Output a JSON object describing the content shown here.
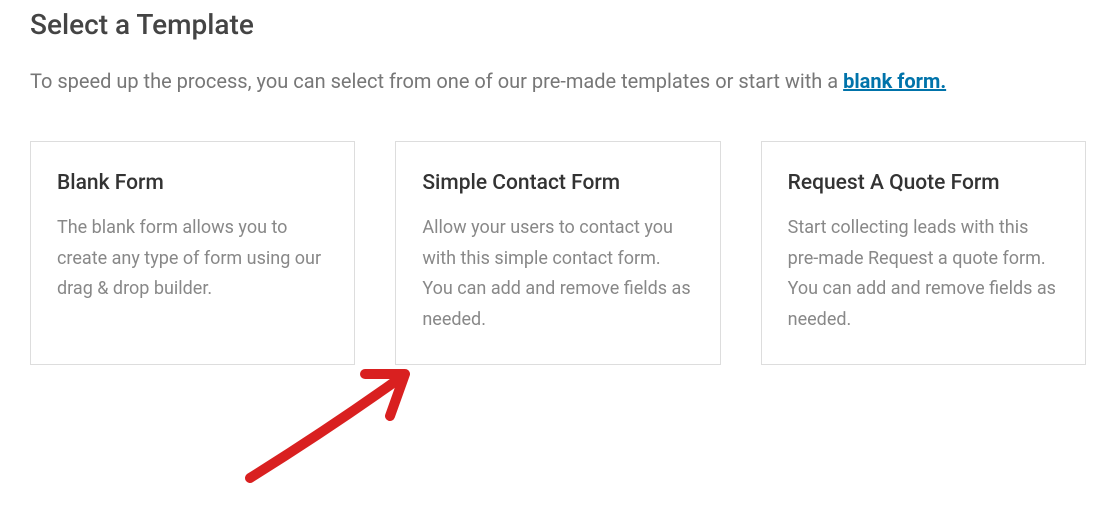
{
  "header": {
    "title": "Select a Template",
    "intro_prefix": "To speed up the process, you can select from one of our pre-made templates or start with a ",
    "intro_link": "blank form."
  },
  "cards": [
    {
      "title": "Blank Form",
      "desc": "The blank form allows you to create any type of form using our drag & drop builder."
    },
    {
      "title": "Simple Contact Form",
      "desc": "Allow your users to contact you with this simple contact form. You can add and remove fields as needed."
    },
    {
      "title": "Request A Quote Form",
      "desc": "Start collecting leads with this pre-made Request a quote form. You can add and remove fields as needed."
    }
  ]
}
